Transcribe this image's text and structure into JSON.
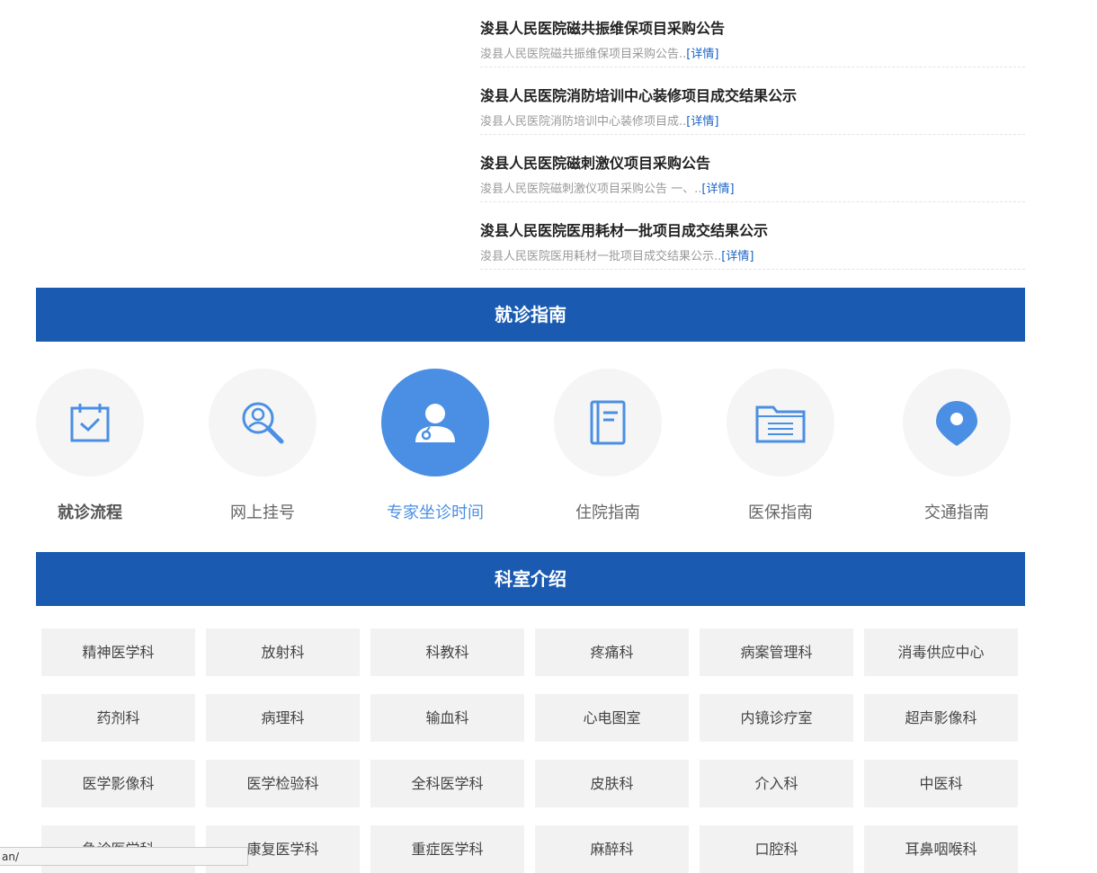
{
  "news": [
    {
      "title": "浚县人民医院磁共振维保项目采购公告",
      "desc": "浚县人民医院磁共振维保项目采购公告..",
      "more": "[详情]"
    },
    {
      "title": "浚县人民医院消防培训中心装修项目成交结果公示",
      "desc": "浚县人民医院消防培训中心装修项目成..",
      "more": "[详情]"
    },
    {
      "title": "浚县人民医院磁刺激仪项目采购公告",
      "desc": "浚县人民医院磁刺激仪项目采购公告 一、..",
      "more": "[详情]"
    },
    {
      "title": "浚县人民医院医用耗材一批项目成交结果公示",
      "desc": "浚县人民医院医用耗材一批项目成交结果公示..",
      "more": "[详情]"
    }
  ],
  "guide_section": {
    "title": "就诊指南"
  },
  "guide_items": [
    {
      "label": "就诊流程",
      "icon": "calendar-check-icon"
    },
    {
      "label": "网上挂号",
      "icon": "doctor-search-icon"
    },
    {
      "label": "专家坐诊时间",
      "icon": "doctor-icon"
    },
    {
      "label": "住院指南",
      "icon": "book-icon"
    },
    {
      "label": "医保指南",
      "icon": "folder-list-icon"
    },
    {
      "label": "交通指南",
      "icon": "location-pin-icon"
    }
  ],
  "dept_section": {
    "title": "科室介绍"
  },
  "departments": [
    "精神医学科",
    "放射科",
    "科教科",
    "疼痛科",
    "病案管理科",
    "消毒供应中心",
    "药剂科",
    "病理科",
    "输血科",
    "心电图室",
    "内镜诊疗室",
    "超声影像科",
    "医学影像科",
    "医学检验科",
    "全科医学科",
    "皮肤科",
    "介入科",
    "中医科",
    "急诊医学科",
    "康复医学科",
    "重症医学科",
    "麻醉科",
    "口腔科",
    "耳鼻咽喉科"
  ],
  "status_url": "an/",
  "colors": {
    "brand": "#1a5bb1",
    "accent": "#4a8fe3",
    "link": "#1a63c6"
  }
}
